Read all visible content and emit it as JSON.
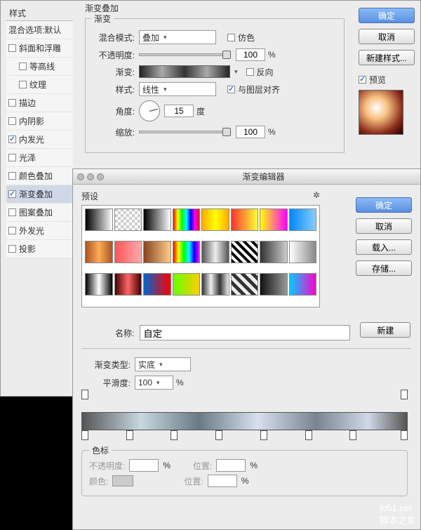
{
  "styles": {
    "header": "样式",
    "blend_defaults": "混合选项:默认",
    "items": [
      {
        "label": "斜面和浮雕",
        "checked": false
      },
      {
        "label": "等高线",
        "checked": false,
        "indent": true
      },
      {
        "label": "纹理",
        "checked": false,
        "indent": true
      },
      {
        "label": "描边",
        "checked": false
      },
      {
        "label": "内阴影",
        "checked": false
      },
      {
        "label": "内发光",
        "checked": true
      },
      {
        "label": "光泽",
        "checked": false
      },
      {
        "label": "颜色叠加",
        "checked": false
      },
      {
        "label": "渐变叠加",
        "checked": true,
        "selected": true
      },
      {
        "label": "图案叠加",
        "checked": false
      },
      {
        "label": "外发光",
        "checked": false
      },
      {
        "label": "投影",
        "checked": false
      }
    ]
  },
  "gradient_overlay": {
    "title": "渐变叠加",
    "group_label": "渐变",
    "blend_mode_label": "混合模式:",
    "blend_mode_value": "叠加",
    "dither_label": "仿色",
    "opacity_label": "不透明度:",
    "opacity_value": "100",
    "percent": "%",
    "gradient_label": "渐变:",
    "reverse_label": "反向",
    "style_label": "样式:",
    "style_value": "线性",
    "align_label": "与图层对齐",
    "angle_label": "角度:",
    "angle_value": "15",
    "degree": "度",
    "scale_label": "缩放:",
    "scale_value": "100"
  },
  "buttons": {
    "ok": "确定",
    "cancel": "取消",
    "new_style": "新建样式...",
    "preview": "预览",
    "load": "载入...",
    "save": "存储...",
    "new": "新建"
  },
  "editor": {
    "title": "渐变编辑器",
    "presets_label": "预设",
    "name_label": "名称:",
    "name_value": "自定",
    "type_label": "渐变类型:",
    "type_value": "实底",
    "smoothness_label": "平滑度:",
    "smoothness_value": "100",
    "percent": "%",
    "stops_title": "色标",
    "opacity_label": "不透明度:",
    "position_label": "位置:",
    "color_label": "颜色:"
  },
  "watermark": {
    "site": "jb51.net",
    "name": "脚本之家"
  },
  "preset_gradients": [
    "linear-gradient(90deg,#000,#fff)",
    "repeating-conic-gradient(#ccc 0 25%,#fff 0 50%) 0/8px 8px",
    "linear-gradient(90deg,#000,#fff)",
    "linear-gradient(90deg,#f00,#ff0,#0f0,#0ff,#00f,#f0f,#f00)",
    "linear-gradient(90deg,#fa0,#ff0,#fa0)",
    "linear-gradient(90deg,#f33,#ff3)",
    "linear-gradient(90deg,#ff0,#f0f)",
    "linear-gradient(90deg,#08f,#8cf)",
    "linear-gradient(90deg,#a52,#fa5,#a52)",
    "linear-gradient(90deg,#f55,#faa)",
    "linear-gradient(90deg,#842,#fc8)",
    "linear-gradient(90deg,#f00,#ff0,#0f0,#0ff,#00f,#f0f)",
    "linear-gradient(90deg,#555,#eee,#555)",
    "repeating-linear-gradient(45deg,#000 0 4px,#fff 0 8px)",
    "linear-gradient(90deg,#333,#ccc)",
    "linear-gradient(90deg,#fff,#888)",
    "linear-gradient(90deg,#000,#fff,#000)",
    "linear-gradient(90deg,#400,#f66,#400)",
    "linear-gradient(90deg,#06c,#f00)",
    "linear-gradient(90deg,#6f0,#fc0)",
    "linear-gradient(90deg,#333,#eee,#333,#eee)",
    "repeating-linear-gradient(45deg,#333 0 5px,#eee 0 10px)",
    "linear-gradient(90deg,#111,#999)",
    "linear-gradient(90deg,#0cf,#f0c)"
  ]
}
